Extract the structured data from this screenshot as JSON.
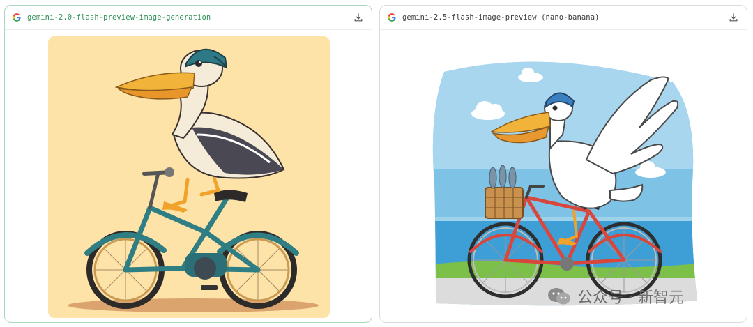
{
  "panels": [
    {
      "model": "gemini-2.0-flash-preview-image-generation",
      "icon": "google-g-icon",
      "action_icon": "download-icon"
    },
    {
      "model": "gemini-2.5-flash-image-preview (nano-banana)",
      "icon": "google-g-icon",
      "action_icon": "download-icon"
    }
  ],
  "watermark": {
    "text": "公众号 · 新智元",
    "icon": "wechat-icon"
  },
  "colors": {
    "left_border": "#a9d8bf",
    "left_model_text": "#2f8f57",
    "right_model_text": "#3a3a3a",
    "left_bg": "#fde3a7",
    "sky": "#7ec2e6",
    "sea": "#3d9fd6"
  }
}
